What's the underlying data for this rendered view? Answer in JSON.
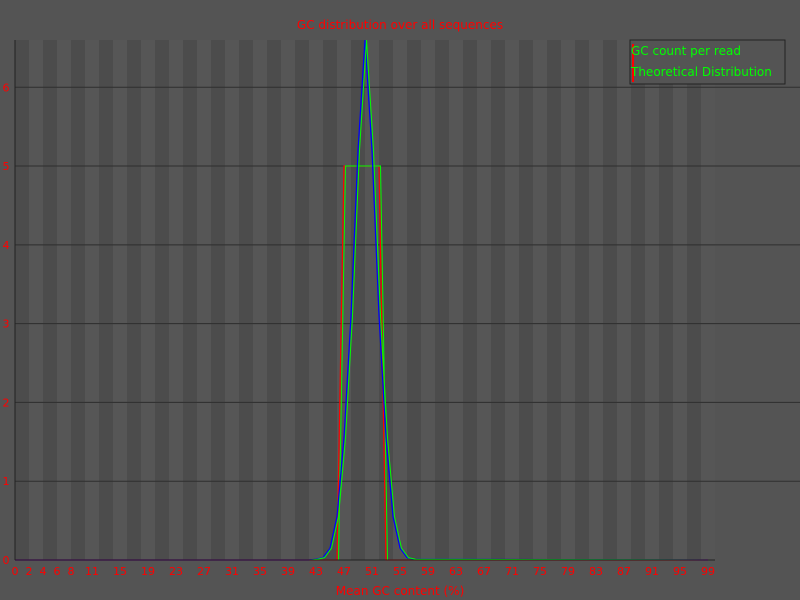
{
  "chart_data": {
    "type": "line",
    "title": "GC distribution over all sequences",
    "xlabel": "Mean GC content (%)",
    "ylabel": "",
    "xlim": [
      0,
      100
    ],
    "ylim": [
      0,
      6.6
    ],
    "x_ticks": [
      0,
      2,
      4,
      6,
      8,
      11,
      15,
      19,
      23,
      27,
      31,
      35,
      39,
      43,
      47,
      51,
      55,
      59,
      63,
      67,
      71,
      75,
      79,
      83,
      87,
      91,
      95,
      99
    ],
    "x_tick_labels": [
      "0",
      "2",
      "4",
      "6",
      "8",
      "11",
      "15",
      "19",
      "23",
      "27",
      "31",
      "35",
      "39",
      "43",
      "47",
      "51",
      "55",
      "59",
      "63",
      "67",
      "71",
      "75",
      "79",
      "83",
      "87",
      "91",
      "95",
      "99"
    ],
    "y_ticks": [
      0,
      1,
      2,
      3,
      4,
      5,
      6
    ],
    "y_tick_labels": [
      "0",
      "1",
      "2",
      "3",
      "4",
      "5",
      "6"
    ],
    "grid": true,
    "legend_position": "top-right",
    "series": [
      {
        "name": "GC count per read",
        "color": "#ff0000",
        "x": [
          0,
          45,
          46,
          47,
          51,
          52,
          53,
          99
        ],
        "y": [
          0,
          0,
          0,
          5,
          5,
          5,
          0,
          0
        ]
      },
      {
        "name": "Theoretical Distribution",
        "color": "#0000ff",
        "x": [
          0,
          42,
          43,
          44,
          45,
          46,
          47,
          48,
          49,
          50,
          51,
          52,
          53,
          54,
          55,
          56,
          57,
          99
        ],
        "y": [
          0,
          0,
          0.01,
          0.03,
          0.15,
          0.55,
          1.55,
          3.1,
          5.2,
          6.6,
          5.2,
          3.1,
          1.55,
          0.55,
          0.15,
          0.03,
          0.01,
          0
        ]
      }
    ]
  }
}
